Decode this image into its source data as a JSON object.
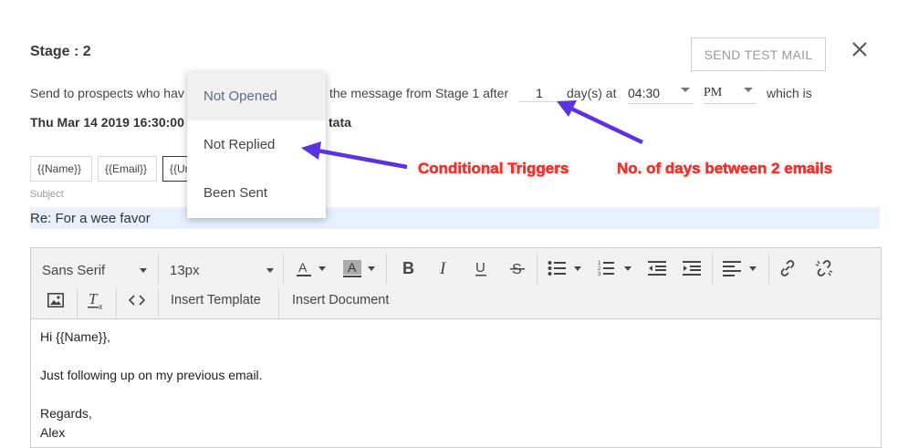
{
  "header": {
    "stage_title": "Stage : 2",
    "send_test_label": "SEND TEST MAIL"
  },
  "condition": {
    "prefix": "Send to prospects who hav",
    "mid": "the message from Stage 1 after",
    "days_value": "1",
    "days_label": "day(s) at",
    "time_value": "04:30",
    "ampm_value": "PM",
    "suffix": "which is",
    "date_prefix": "Thu Mar 14 2019 16:30:00",
    "date_suffix": "tata"
  },
  "merge_tags": [
    "{{Name}}",
    "{{Email}}",
    "{{Un"
  ],
  "subject": {
    "label": "Subject",
    "value": "Re: For a wee favor"
  },
  "toolbar": {
    "font_family": "Sans Serif",
    "font_size": "13px",
    "insert_template": "Insert Template",
    "insert_document": "Insert Document"
  },
  "email_body": {
    "greeting": "Hi {{Name}},",
    "line1": "Just following up on my previous email.",
    "sign_off": "Regards,",
    "name": "Alex"
  },
  "trigger_dropdown": {
    "options": [
      "Not Opened",
      "Not Replied",
      "Been Sent"
    ],
    "highlighted_index": 0
  },
  "annotations": {
    "conditional": "Conditional Triggers",
    "days": "No. of days between 2 emails",
    "color": "#f0332d",
    "arrow_color": "#5b32e0"
  },
  "colors": {
    "subject_bg": "#e8f0fe",
    "toolbar_bg": "#f1f1f1"
  }
}
